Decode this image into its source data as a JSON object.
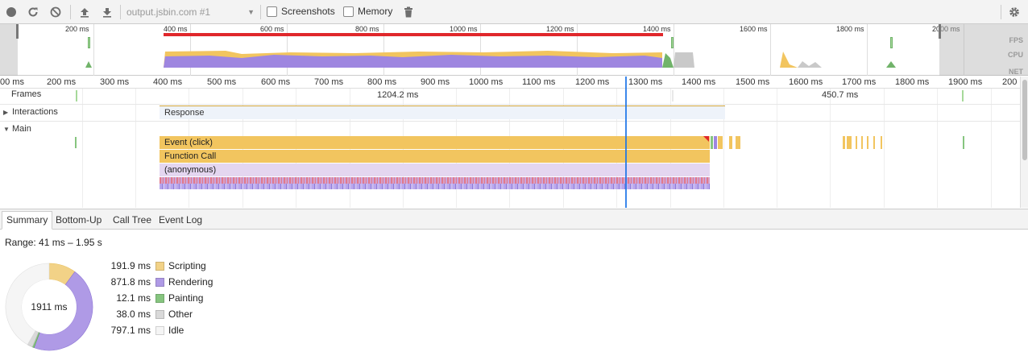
{
  "toolbar": {
    "url": "output.jsbin.com #1",
    "screenshots_label": "Screenshots",
    "memory_label": "Memory"
  },
  "overview": {
    "labels": [
      "200 ms",
      "400 ms",
      "600 ms",
      "800 ms",
      "1000 ms",
      "1200 ms",
      "1400 ms",
      "1600 ms",
      "1800 ms",
      "2000 ms"
    ],
    "side_labels": {
      "fps": "FPS",
      "cpu": "CPU",
      "net": "NET"
    }
  },
  "ruler": {
    "labels": [
      "00 ms",
      "200 ms",
      "300 ms",
      "400 ms",
      "500 ms",
      "600 ms",
      "700 ms",
      "800 ms",
      "900 ms",
      "1000 ms",
      "1100 ms",
      "1200 ms",
      "1300 ms",
      "1400 ms",
      "1500 ms",
      "1600 ms",
      "1700 ms",
      "1800 ms",
      "1900 ms",
      "200"
    ]
  },
  "tracks": {
    "frames_label": "Frames",
    "frame_duration_1": "1204.2 ms",
    "frame_duration_2": "450.7 ms",
    "interactions_label": "Interactions",
    "response_label": "Response",
    "main_label": "Main",
    "events": [
      "Event (click)",
      "Function Call",
      "(anonymous)"
    ]
  },
  "tabs": [
    "Summary",
    "Bottom-Up",
    "Call Tree",
    "Event Log"
  ],
  "summary": {
    "range": "Range: 41 ms – 1.95 s",
    "total": "1911 ms",
    "items": [
      {
        "value": "191.9 ms",
        "name": "Scripting",
        "ms": 191.9,
        "color": "#f2d287"
      },
      {
        "value": "871.8 ms",
        "name": "Rendering",
        "ms": 871.8,
        "color": "#af9ae6"
      },
      {
        "value": "12.1 ms",
        "name": "Painting",
        "ms": 12.1,
        "color": "#86c57f"
      },
      {
        "value": "38.0 ms",
        "name": "Other",
        "ms": 38.0,
        "color": "#d9d9d9"
      },
      {
        "value": "797.1 ms",
        "name": "Idle",
        "ms": 797.1,
        "color": "#f5f5f5"
      }
    ]
  },
  "colors": {
    "scripting": "#f2c55f",
    "rendering": "#9e86e0",
    "painting": "#71b36a",
    "selection": "#1a73e8",
    "long_task": "#e0272b"
  }
}
